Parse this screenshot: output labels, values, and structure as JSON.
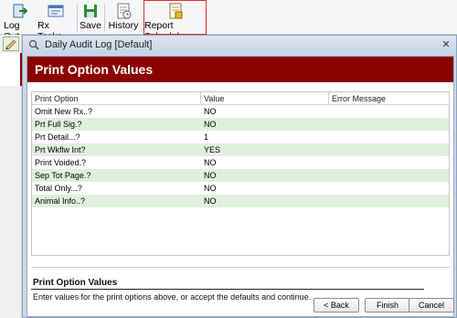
{
  "toolbar": {
    "logout_label": "Log Out",
    "rxtasks_label": "Rx Tasks",
    "save_label": "Save",
    "history_label": "History",
    "report_scheduler_label": "Report Scheduler"
  },
  "window": {
    "title": "Daily Audit Log [Default]",
    "close_glyph": "✕"
  },
  "header": {
    "title": "Print Option Values"
  },
  "grid": {
    "columns": [
      "Print Option",
      "Value",
      "Error Message"
    ],
    "rows": [
      {
        "option": "Omit New Rx..?",
        "value": "NO"
      },
      {
        "option": "Prt Full Sig.?",
        "value": "NO"
      },
      {
        "option": "Prt Detail...?",
        "value": "1"
      },
      {
        "option": "Prt Wkflw Int?",
        "value": "YES"
      },
      {
        "option": "Print Voided.?",
        "value": "NO"
      },
      {
        "option": "Sep Tot Page.?",
        "value": "NO"
      },
      {
        "option": "Total Only...?",
        "value": "NO"
      },
      {
        "option": "Animal Info..?",
        "value": "NO"
      }
    ]
  },
  "description": {
    "title": "Print Option Values",
    "text": "Enter values for the print options above, or accept the defaults and continue."
  },
  "buttons": {
    "back": "< Back",
    "finish": "Finish",
    "cancel": "Cancel"
  },
  "colors": {
    "header_band": "#8b0000",
    "alt_row": "#dff1dc",
    "highlight": "#e03030"
  }
}
